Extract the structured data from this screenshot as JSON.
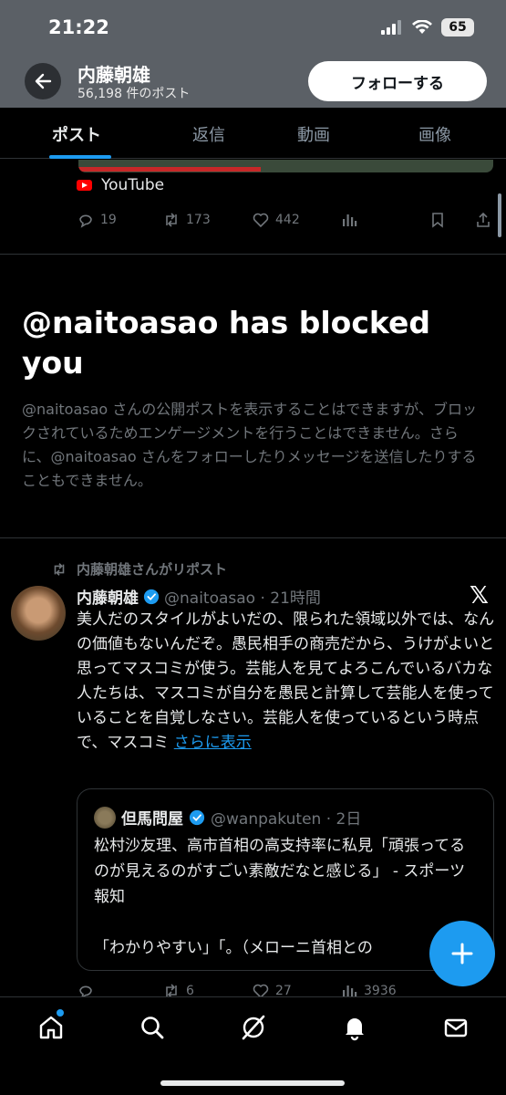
{
  "status": {
    "time": "21:22",
    "battery": "65"
  },
  "header": {
    "name": "内藤朝雄",
    "post_count": "56,198 件のポスト",
    "follow_label": "フォローする"
  },
  "tabs": [
    {
      "label": "ポスト",
      "active": true
    },
    {
      "label": "返信",
      "active": false
    },
    {
      "label": "動画",
      "active": false
    },
    {
      "label": "画像",
      "active": false
    }
  ],
  "video_progress_fraction": 0.44,
  "prev_tweet": {
    "source": "YouTube",
    "replies": "19",
    "reposts": "173",
    "likes": "442"
  },
  "blocked": {
    "title": "@naitoasao has blocked you",
    "description": "@naitoasao さんの公開ポストを表示することはできますが、ブロックされているためエンゲージメントを行うことはできません。さらに、@naitoasao さんをフォローしたりメッセージを送信したりすることもできません。"
  },
  "tweet": {
    "repost_label": "内藤朝雄さんがリポスト",
    "author": "内藤朝雄",
    "handle_time": "@naitoasao · 21時間",
    "body": "美人だのスタイルがよいだの、限られた領域以外では、なんの価値もないんだぞ。愚民相手の商売だから、うけがよいと思ってマスコミが使う。芸能人を見てよろこんでいるバカな人たちは、マスコミが自分を愚民と計算して芸能人を使っていることを自覚しなさい。芸能人を使っているという時点で、マスコミ ",
    "show_more": "さらに表示",
    "quote": {
      "author": "但馬問屋",
      "handle_time": "@wanpakuten · 2日",
      "text": "松村沙友理、高市首相の高支持率に私見「頑張ってるのが見えるのがすごい素敵だなと感じる」 - スポーツ報知",
      "text2": "「わかりやすい」「。（メローニ首相との"
    },
    "stats": {
      "reposts": "6",
      "likes": "27",
      "views": "3936"
    }
  },
  "colors": {
    "accent": "#1d9bf0",
    "background": "#000000",
    "header": "#5b6066",
    "muted": "#71767b"
  },
  "icons": [
    "back-arrow-icon",
    "youtube-icon",
    "reply-icon",
    "repost-icon",
    "like-icon",
    "views-icon",
    "bookmark-icon",
    "share-icon",
    "verified-icon",
    "x-logo-icon",
    "plus-icon",
    "home-icon",
    "search-icon",
    "grok-icon",
    "bell-icon",
    "mail-icon"
  ]
}
